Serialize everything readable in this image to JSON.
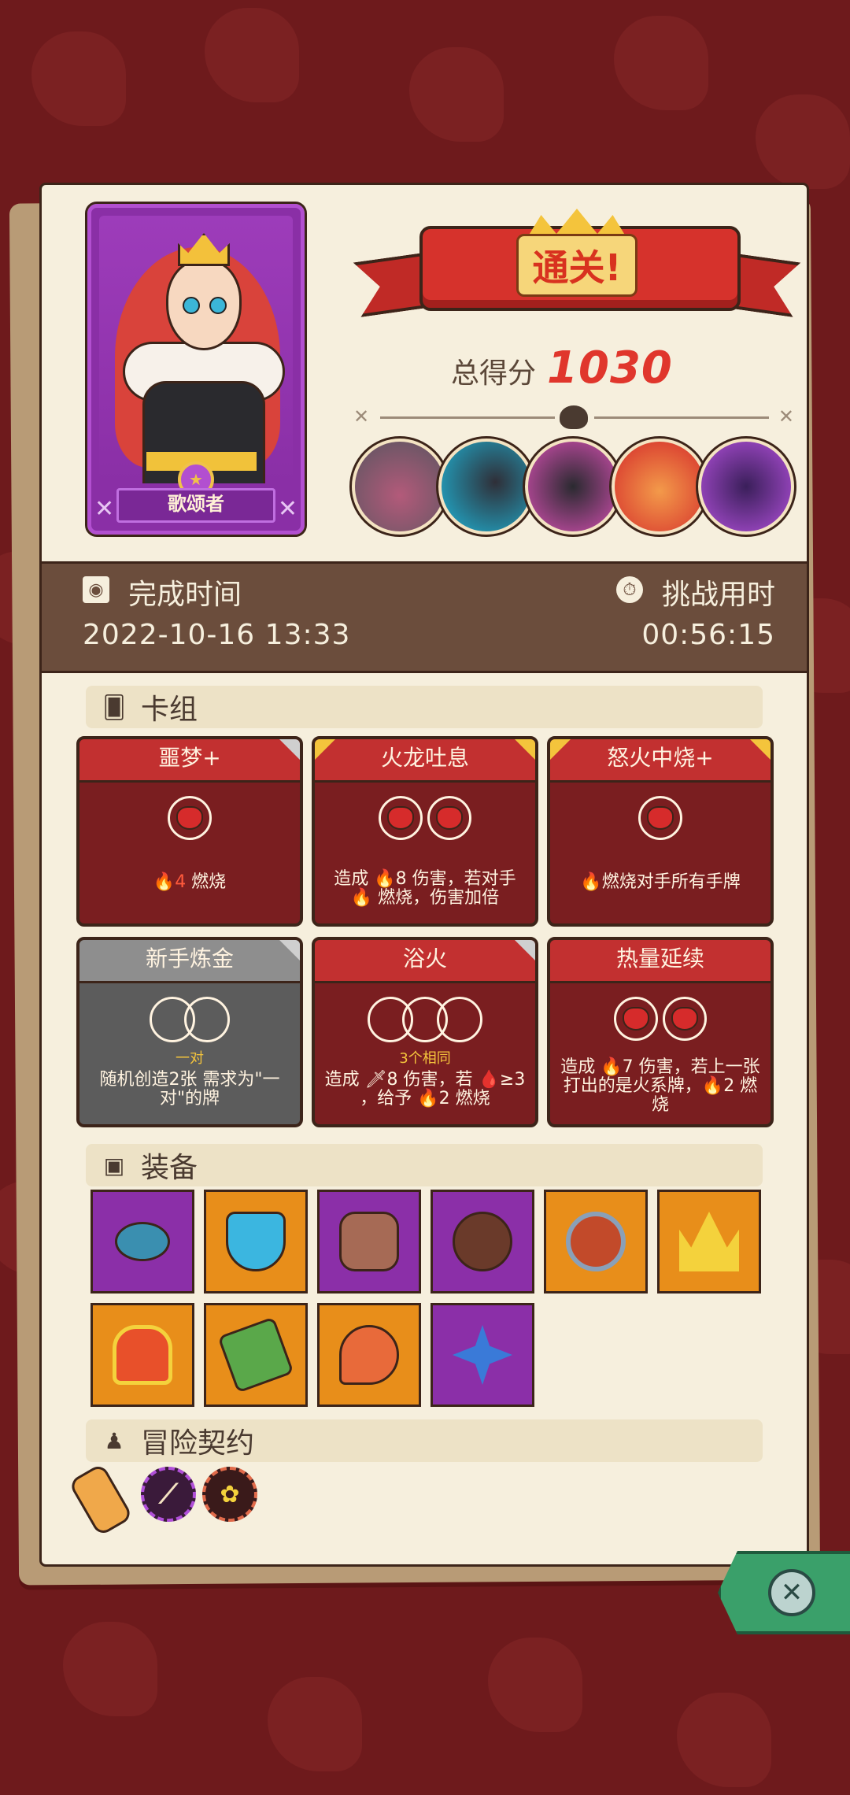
{
  "hero": {
    "name": "歌颂者"
  },
  "result": {
    "banner": "通关!",
    "score_label": "总得分",
    "score_value": "1030"
  },
  "bosses": [
    {
      "name": "stone-golem-boss-avatar"
    },
    {
      "name": "shadow-beast-boss-avatar"
    },
    {
      "name": "dark-knight-boss-avatar"
    },
    {
      "name": "ringmaster-boss-avatar"
    },
    {
      "name": "purple-demon-boss-avatar"
    }
  ],
  "time": {
    "completion_label": "完成时间",
    "completion_value": "2022-10-16 13:33",
    "duration_label": "挑战用时",
    "duration_value": "00:56:15"
  },
  "deck": {
    "title": "卡组",
    "cards": [
      {
        "title": "噩梦+",
        "desc": [
          "🔥4",
          " 燃烧"
        ],
        "style": "red"
      },
      {
        "title": "火龙吐息",
        "desc": "造成 🔥8 伤害，若对手 🔥 燃烧，伤害加倍",
        "style": "red"
      },
      {
        "title": "怒火中烧+",
        "desc": "🔥燃烧对手所有手牌",
        "style": "red"
      },
      {
        "title": "新手炼金",
        "sub": "一对",
        "desc": "随机创造2张 需求为\"一对\"的牌",
        "style": "gray"
      },
      {
        "title": "浴火",
        "sub": "3个相同",
        "desc": "造成 🗡8 伤害，若 🩸≥3 ，给予 🔥2 燃烧",
        "style": "red"
      },
      {
        "title": "热量延续",
        "desc": "造成 🔥7 伤害，若上一张打出的是火系牌，🔥2 燃烧",
        "style": "red"
      }
    ]
  },
  "equipment": {
    "title": "装备",
    "items": [
      {
        "name": "leaf-ring-icon",
        "bg": "purple"
      },
      {
        "name": "ice-shield-icon",
        "bg": "orange"
      },
      {
        "name": "fire-rune-stone-icon",
        "bg": "purple"
      },
      {
        "name": "wooden-button-icon",
        "bg": "purple"
      },
      {
        "name": "lava-amulet-icon",
        "bg": "orange"
      },
      {
        "name": "gold-crown-icon",
        "bg": "orange"
      },
      {
        "name": "flame-crown-icon",
        "bg": "orange"
      },
      {
        "name": "mossy-stone-icon",
        "bg": "orange"
      },
      {
        "name": "meat-leg-icon",
        "bg": "orange"
      },
      {
        "name": "spiked-crystal-icon",
        "bg": "purple"
      }
    ]
  },
  "contracts": {
    "title": "冒险契约",
    "items": [
      {
        "name": "scroll-icon"
      },
      {
        "name": "bone-icon"
      },
      {
        "name": "flower-pot-icon"
      }
    ]
  },
  "colors": {
    "background": "#6e1a1c",
    "panel": "#f6efdd",
    "accent_red": "#e0362c",
    "band": "#6b4d3c"
  }
}
